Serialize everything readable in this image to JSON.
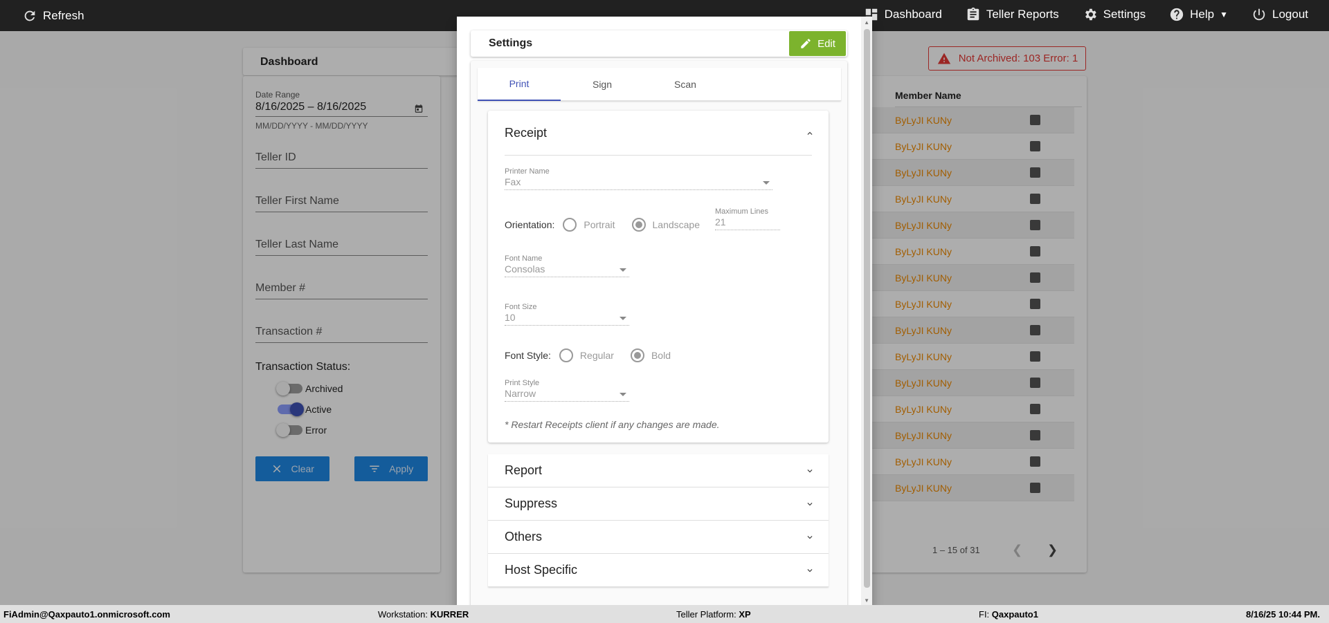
{
  "topbar": {
    "refresh": "Refresh",
    "nav": [
      {
        "label": "Dashboard",
        "icon": "dashboard-icon"
      },
      {
        "label": "Teller Reports",
        "icon": "clipboard-icon"
      },
      {
        "label": "Settings",
        "icon": "gear-icon"
      },
      {
        "label": "Help",
        "icon": "help-icon"
      },
      {
        "label": "Logout",
        "icon": "power-icon"
      }
    ]
  },
  "dashboard": {
    "title": "Dashboard",
    "filters": {
      "date_range_label": "Date Range",
      "date_range_value": "8/16/2025 – 8/16/2025",
      "date_hint": "MM/DD/YYYY - MM/DD/YYYY",
      "teller_id": "Teller ID",
      "teller_first": "Teller First Name",
      "teller_last": "Teller Last Name",
      "member": "Member #",
      "transaction": "Transaction #",
      "status_label": "Transaction Status:",
      "status": [
        {
          "label": "Archived",
          "on": false
        },
        {
          "label": "Active",
          "on": true
        },
        {
          "label": "Error",
          "on": false
        }
      ],
      "clear": "Clear",
      "apply": "Apply"
    },
    "error_badge": "Not Archived: 103  Error: 1",
    "table": {
      "header": "Member Name",
      "rows": [
        "ByLyJI KUNy",
        "ByLyJI KUNy",
        "ByLyJI KUNy",
        "ByLyJI KUNy",
        "ByLyJI KUNy",
        "ByLyJI KUNy",
        "ByLyJI KUNy",
        "ByLyJI KUNy",
        "ByLyJI KUNy",
        "ByLyJI KUNy",
        "ByLyJI KUNy",
        "ByLyJI KUNy",
        "ByLyJI KUNy",
        "ByLyJI KUNy",
        "ByLyJI KUNy"
      ],
      "pager": "1 – 15 of 31"
    }
  },
  "dialog": {
    "title": "Settings",
    "edit": "Edit",
    "tabs": [
      "Print",
      "Sign",
      "Scan"
    ],
    "receipt": {
      "title": "Receipt",
      "printer_name_label": "Printer Name",
      "printer_name": "Fax",
      "orientation_label": "Orientation:",
      "orientation_options": [
        "Portrait",
        "Landscape"
      ],
      "max_lines_label": "Maximum Lines",
      "max_lines": "21",
      "font_name_label": "Font Name",
      "font_name": "Consolas",
      "font_size_label": "Font Size",
      "font_size": "10",
      "font_style_label": "Font Style:",
      "font_style_options": [
        "Regular",
        "Bold"
      ],
      "print_style_label": "Print Style",
      "print_style": "Narrow",
      "note": "* Restart Receipts client if any changes are made."
    },
    "sections": [
      "Report",
      "Suppress",
      "Others",
      "Host Specific"
    ]
  },
  "statusbar": {
    "user": "FiAdmin@Qaxpauto1.onmicrosoft.com",
    "workstation_key": "Workstation:",
    "workstation": "KURRER",
    "platform_key": "Teller Platform:",
    "platform": "XP",
    "fi_key": "FI:",
    "fi": "Qaxpauto1",
    "datetime": "8/16/25 10:44 PM."
  }
}
